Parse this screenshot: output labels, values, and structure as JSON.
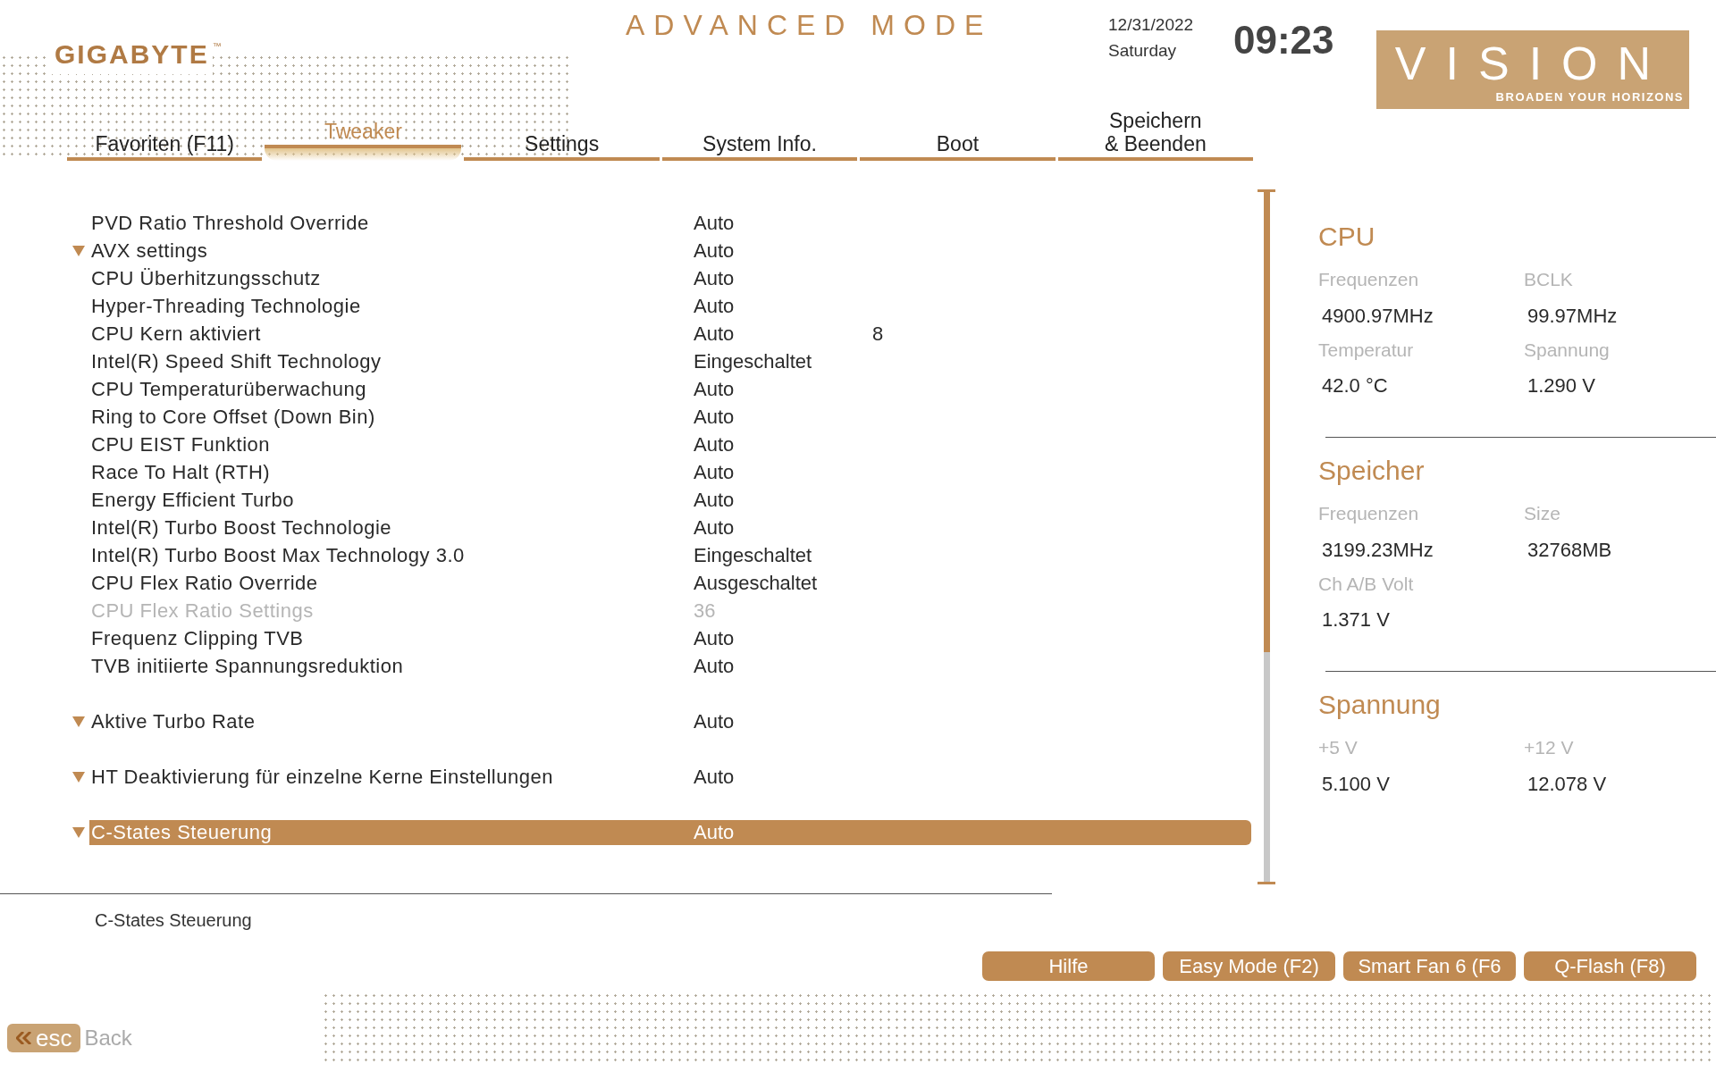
{
  "header": {
    "brand": "GIGABYTE",
    "brand_mark": "™",
    "mode": "ADVANCED MODE",
    "date": "12/31/2022",
    "weekday": "Saturday",
    "time": "09:23",
    "logo_text": "VISION",
    "slogan": "BROADEN YOUR HORIZONS"
  },
  "tabs": [
    {
      "label": "Favoriten (F11)",
      "selected": false
    },
    {
      "label": "Tweaker",
      "selected": true
    },
    {
      "label": "Settings",
      "selected": false
    },
    {
      "label": "System Info.",
      "selected": false
    },
    {
      "label": "Boot",
      "selected": false
    },
    {
      "label": "Speichern\n& Beenden",
      "selected": false
    }
  ],
  "settings_groups": [
    [
      {
        "kind": "item",
        "label": "PVD Ratio Threshold Override",
        "value": "Auto",
        "disabled": false,
        "selected": false
      },
      {
        "kind": "submenu",
        "label": "AVX settings",
        "value": "Auto",
        "disabled": false,
        "selected": false
      },
      {
        "kind": "item",
        "label": "CPU Überhitzungsschutz",
        "value": "Auto",
        "disabled": false,
        "selected": false
      },
      {
        "kind": "item",
        "label": "Hyper-Threading Technologie",
        "value": "Auto",
        "disabled": false,
        "selected": false
      },
      {
        "kind": "item",
        "label": "CPU Kern aktiviert",
        "value": "Auto",
        "extra": "8",
        "disabled": false,
        "selected": false
      },
      {
        "kind": "item",
        "label": "Intel(R) Speed Shift Technology",
        "value": "Eingeschaltet",
        "disabled": false,
        "selected": false
      },
      {
        "kind": "item",
        "label": "CPU Temperaturüberwachung",
        "value": "Auto",
        "disabled": false,
        "selected": false
      },
      {
        "kind": "item",
        "label": "Ring to Core Offset (Down Bin)",
        "value": "Auto",
        "disabled": false,
        "selected": false
      },
      {
        "kind": "item",
        "label": "CPU EIST Funktion",
        "value": "Auto",
        "disabled": false,
        "selected": false
      },
      {
        "kind": "item",
        "label": "Race To Halt (RTH)",
        "value": "Auto",
        "disabled": false,
        "selected": false
      },
      {
        "kind": "item",
        "label": "Energy Efficient Turbo",
        "value": "Auto",
        "disabled": false,
        "selected": false
      },
      {
        "kind": "item",
        "label": "Intel(R) Turbo Boost Technologie",
        "value": "Auto",
        "disabled": false,
        "selected": false
      },
      {
        "kind": "item",
        "label": "Intel(R) Turbo Boost Max Technology 3.0",
        "value": "Eingeschaltet",
        "disabled": false,
        "selected": false
      },
      {
        "kind": "item",
        "label": "CPU Flex Ratio Override",
        "value": "Ausgeschaltet",
        "disabled": false,
        "selected": false
      },
      {
        "kind": "item",
        "label": "CPU Flex Ratio Settings",
        "value": "36",
        "disabled": true,
        "selected": false
      },
      {
        "kind": "item",
        "label": "Frequenz Clipping TVB",
        "value": "Auto",
        "disabled": false,
        "selected": false
      },
      {
        "kind": "item",
        "label": "TVB initiierte Spannungsreduktion",
        "value": "Auto",
        "disabled": false,
        "selected": false
      }
    ],
    [
      {
        "kind": "submenu",
        "label": "Aktive Turbo Rate",
        "value": "Auto",
        "disabled": false,
        "selected": false
      }
    ],
    [
      {
        "kind": "submenu",
        "label": "HT Deaktivierung für einzelne Kerne Einstellungen",
        "value": "Auto",
        "disabled": false,
        "selected": false
      }
    ],
    [
      {
        "kind": "submenu",
        "label": "C-States Steuerung",
        "value": "Auto",
        "disabled": false,
        "selected": true
      }
    ]
  ],
  "help_text": "C-States Steuerung",
  "monitor": [
    {
      "title": "CPU",
      "fields": [
        {
          "label": "Frequenzen",
          "value": "4900.97MHz"
        },
        {
          "label": "BCLK",
          "value": "99.97MHz"
        },
        {
          "label": "Temperatur",
          "value": "42.0 °C"
        },
        {
          "label": "Spannung",
          "value": "1.290 V"
        }
      ]
    },
    {
      "title": "Speicher",
      "fields": [
        {
          "label": "Frequenzen",
          "value": "3199.23MHz"
        },
        {
          "label": "Size",
          "value": "32768MB"
        },
        {
          "label": "Ch A/B Volt",
          "value": "1.371 V"
        }
      ]
    },
    {
      "title": "Spannung",
      "fields": [
        {
          "label": "+5 V",
          "value": "5.100 V"
        },
        {
          "label": "+12 V",
          "value": "12.078 V"
        }
      ]
    }
  ],
  "buttons": [
    "Hilfe",
    "Easy Mode (F2)",
    "Smart Fan 6 (F6",
    "Q-Flash (F8)"
  ],
  "esc": {
    "key": "esc",
    "label": "Back"
  }
}
